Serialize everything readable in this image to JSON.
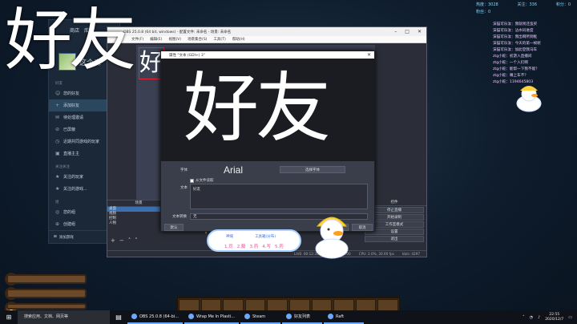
{
  "overlay": {
    "big_text": "好友"
  },
  "stats": {
    "left_label": "热度：3028",
    "mid_label": "关注：336",
    "right_label": "粉丝：0"
  },
  "chat": [
    "沫猫可乐汝：我就残还蛮买",
    "沫猫可乐汝：沾水码进度",
    "沫猫可乐汝：我出啊所到框",
    "沫猫可乐汝：今天的第一帧呢",
    "沫猫可乐汝：加此登我马车",
    "ztg小蛇：初游入直播间",
    "ztg小蛇：一个入们啊",
    "ztg小蛇：能帮一下我不能？",
    "ztg小蛇：嘴上车不？",
    "ztg小蛇：1194645803"
  ],
  "steam": {
    "menu": [
      "商店",
      "库"
    ],
    "friend_name": "这个森",
    "section_friends": "好友",
    "items": [
      {
        "icon": "users-icon",
        "label": "您的好友"
      },
      {
        "icon": "user-add-icon",
        "label": "添加好友"
      },
      {
        "icon": "pending-icon",
        "label": "待处理邀请"
      },
      {
        "icon": "block-icon",
        "label": "已屏蔽"
      },
      {
        "icon": "history-icon",
        "label": "近期共同游戏的玩家"
      },
      {
        "icon": "stream-icon",
        "label": "直播主主"
      }
    ],
    "section_follow": "关注关注",
    "follow_items": [
      {
        "icon": "follow-icon",
        "label": "关注的玩家"
      },
      {
        "icon": "follow-icon",
        "label": "关注的游戏..."
      }
    ],
    "section_groups": "组",
    "group_items": [
      {
        "icon": "group-icon",
        "label": "您的组"
      },
      {
        "icon": "group-add-icon",
        "label": "创建组"
      }
    ],
    "bottom": "添加游戏"
  },
  "obs": {
    "title": "OBS 25.0.8 (64 bit, windows) - 配置文件: 未命名 - 场景: 未命名",
    "menu": [
      "文件(F)",
      "编辑(E)",
      "视图(V)",
      "场景集合(S)",
      "工具(T)",
      "帮助(H)"
    ],
    "preview_text": "好友",
    "scenes_header": "场景",
    "scenes": [
      "桌面",
      "视频",
      "控制",
      "人物"
    ],
    "controls_header": "控件",
    "controls": [
      "停止直播",
      "开始录制",
      "工作室模式",
      "设置",
      "退出"
    ],
    "status": [
      "LIVE: 00:12:35",
      "REC: 00:00:00",
      "CPU: 2.0%, 30.00 fps",
      "kb/s: 4297"
    ]
  },
  "dialog": {
    "title": "属性 \"文本 (GDI+) 3\"",
    "preview_text": "好友",
    "font_label": "字体",
    "font_value": "Arial",
    "font_button": "选择字体",
    "checkbox_label": "从文件读取",
    "text_label": "文本",
    "text_value": "好友",
    "transform_label": "文本转换",
    "transform_value": "无",
    "defaults_button": "默认",
    "ok_button": "确定",
    "cancel_button": "取消"
  },
  "sticker": {
    "left_label": "神域",
    "right_label": "工具箱(分布)",
    "nums": [
      "1.司",
      "2.藤",
      "3.药",
      "4.写",
      "5.药"
    ]
  },
  "taskbar": {
    "search": "搜索应用、文档、网页等",
    "apps": [
      "OBS 25.0.8 (64-bi...",
      "Wrap Me In Plasti...",
      "Steam",
      "好友列表",
      "Raft"
    ],
    "time": "22:55",
    "date": "2020/12/7"
  },
  "colors": {
    "accent": "#6aa9ff",
    "chat": "#e9c7ff",
    "stats": "#7fd7ff"
  }
}
